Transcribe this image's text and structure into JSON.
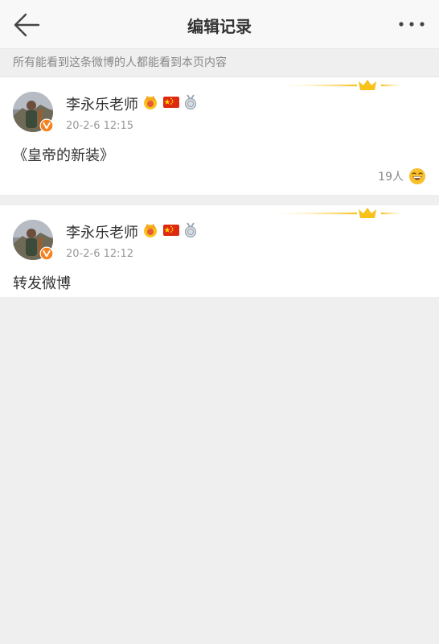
{
  "header": {
    "title": "编辑记录",
    "back_icon": "arrow-left-icon",
    "more_icon": "more-dots-icon"
  },
  "notice": {
    "text": "所有能看到这条微博的人都能看到本页内容"
  },
  "records": [
    {
      "author": "李永乐老师",
      "timestamp": "20-2-6 12:15",
      "text": "《皇帝的新装》",
      "likes": "19人",
      "badges": [
        "crown-vip-icon",
        "china-flag-icon",
        "medal-icon"
      ],
      "verified_icon": "verified-v-icon"
    },
    {
      "author": "李永乐老师",
      "timestamp": "20-2-6 12:12",
      "text": "转发微博",
      "badges": [
        "crown-vip-icon",
        "china-flag-icon",
        "medal-icon"
      ],
      "verified_icon": "verified-v-icon"
    }
  ],
  "colors": {
    "page_bg": "#efefef",
    "card_bg": "#ffffff",
    "accent_orange": "#f5a623",
    "flag_red": "#de2910",
    "crown_gold": "#f7c21a",
    "verified_orange": "#f5821f"
  }
}
